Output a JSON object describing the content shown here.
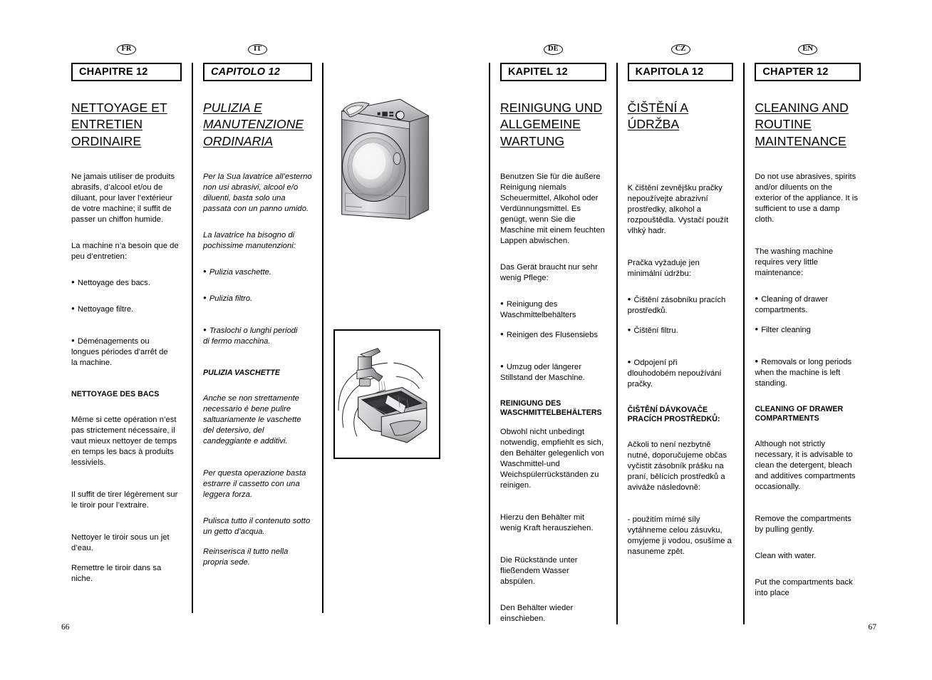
{
  "document": {
    "chapter_number": "12",
    "page_left": "66",
    "page_right": "67"
  },
  "columns": {
    "fr": {
      "badge": "FR",
      "chapter_label": "CHAPITRE 12",
      "title": [
        "NETTOYAGE ET",
        "ENTRETIEN",
        "ORDINAIRE"
      ],
      "intro": "Ne jamais utiliser de produits abrasifs, d’alcool et/ou de diluant, pour laver l’extérieur de votre machine; il suffit de passer un chiffon humide.",
      "lead": "La machine n’a besoin que de peu d’entretien:",
      "bullets": [
        "Nettoyage des bacs.",
        "Nettoyage filtre.",
        "Déménagements ou\nlongues périodes d’arrêt de\nla machine."
      ],
      "sub_head": "NETTOYAGE DES BACS",
      "paragraphs": [
        "Même si cette opération n’est pas strictement nécessaire, il vaut mieux nettoyer de temps en temps les bacs à produits lessiviels.",
        "Il suffit de tirer légèrement sur le tiroir pour l’extraire.",
        "Nettoyer le tiroir sous un jet d’eau.",
        "Remettre le tiroir dans sa niche."
      ]
    },
    "it": {
      "badge": "IT",
      "chapter_label": "CAPITOLO 12",
      "title": [
        "PULIZIA E",
        "MANUTENZIONE",
        "ORDINARIA"
      ],
      "intro": "Per la Sua lavatrice all’esterno non usi abrasivi, alcool e/o diluenti, basta solo una passata con un panno umido.",
      "lead": "La lavatrice ha bisogno di pochissime manutenzioni:",
      "bullets": [
        "Pulizia vaschette.",
        "Pulizia filtro.",
        "Traslochi o lunghi periodi\ndi fermo macchina."
      ],
      "sub_head": "PULIZIA VASCHETTE",
      "paragraphs": [
        "Anche se non strettamente necessario é bene pulire saltuariamente le vaschette del detersivo, del candeggiante e additivi.",
        "Per questa operazione basta estrarre il cassetto con una leggera forza.",
        "Pulisca tutto il contenuto sotto un getto d’acqua.",
        "Reinserisca il tutto nella propria sede."
      ]
    },
    "de": {
      "badge": "DE",
      "chapter_label": "KAPITEL 12",
      "title": [
        "REINIGUNG UND",
        "ALLGEMEINE",
        "WARTUNG"
      ],
      "intro": "Benutzen Sie für die äußere Reinigung niemals Scheuermittel, Alkohol oder Verdünnungsmittel. Es genügt, wenn Sie die Maschine mit einem feuchten Lappen abwischen.",
      "lead": "Das Gerät braucht nur sehr wenig Pflege:",
      "bullets": [
        "Reinigung des\nWaschmittelbehälters",
        "Reinigen des Flusensiebs",
        "Umzug oder längerer\nStillstand der Maschine."
      ],
      "sub_head": "REINIGUNG DES\nWASCHMITTELBEHÄLTERS",
      "paragraphs": [
        "Obwohl nicht unbedingt notwendig, empfiehlt es sich, den Behälter gelegenlich von Waschmittel-und Weichspülerrückständen zu reinigen.",
        "Hierzu den Behälter mit wenig Kraft herausziehen.",
        "Die Rückstände unter fließendem Wasser abspülen.",
        "Den Behälter wieder einschieben."
      ]
    },
    "cz": {
      "badge": "CZ",
      "chapter_label": "KAPITOLA 12",
      "title": [
        "ČIŠTĚNÍ A ÚDRŽBA"
      ],
      "intro": "K čištění zevnějšku pračky nepoužívejte abrazivní prostředky, alkohol a rozpouštědla. Vystačí použít vlhký hadr.",
      "lead": "Pračka vyžaduje jen minimální údržbu:",
      "bullets": [
        "Čištění zásobníku  pracích\nprostředků.",
        "Čištění filtru.",
        "Odpojení při\ndlouhodobém nepoužívání\npračky."
      ],
      "sub_head": "ČIŠTĚNÍ DÁVKOVAČE\nPRACÍCH PROSTŘEDKŮ:",
      "paragraphs": [
        "Ačkoli to není nezbytně nutné, doporučujeme občas vyčistit zásobník  prášku na praní, bělících prostředků a aviváže následovně:",
        "- použitím mírné síly vytáhneme celou zásuvku, omyjeme ji vodou, osušíme a nasuneme zpět."
      ]
    },
    "en": {
      "badge": "EN",
      "chapter_label": "CHAPTER 12",
      "title": [
        "CLEANING AND",
        "ROUTINE",
        "MAINTENANCE"
      ],
      "intro": "Do not use abrasives, spirits and/or diluents on the exterior of the appliance. It is sufficient to use a damp cloth.",
      "lead": "The washing machine requires very little maintenance:",
      "bullets": [
        "Cleaning of drawer\ncompartments.",
        "Filter cleaning",
        "Removals or long periods\nwhen the machine is left\nstanding."
      ],
      "sub_head": "CLEANING OF DRAWER\nCOMPARTMENTS",
      "paragraphs": [
        "Although not strictly necessary, it is advisable to clean the detergent, bleach and additives compartments occasionally.",
        "Remove the compartments by pulling gently.",
        "Clean with water.",
        "Put the compartments back into place"
      ]
    }
  },
  "illustrations": {
    "machine": "front-loading-washing-machine",
    "drawer": "detergent-drawer-rinsed-under-tap"
  }
}
